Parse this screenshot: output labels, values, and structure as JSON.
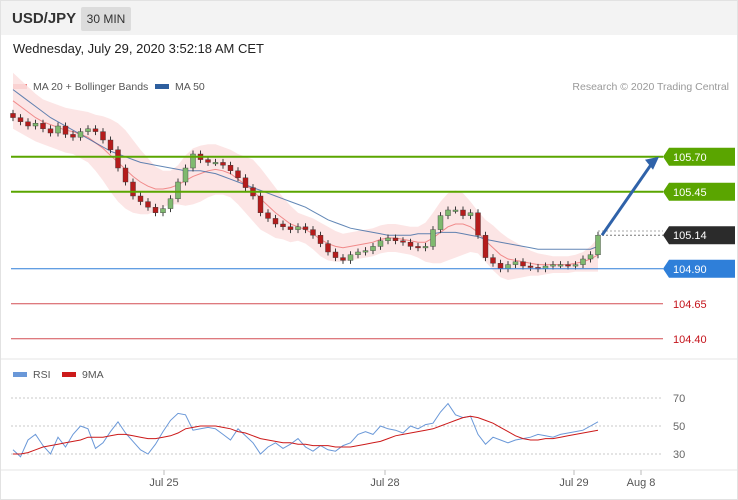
{
  "header": {
    "symbol": "USD/JPY",
    "timeframe": "30 MIN",
    "timestamp": "Wednesday, July 29, 2020 3:52:18 AM CET"
  },
  "credit": "Research © 2020 Trading Central",
  "colors": {
    "ma20_bands": "#f08080",
    "band_fill": "#fbe0e0",
    "ma50": "#2e5f9e",
    "resistance": "#5aa500",
    "support_blue": "#2f7fd9",
    "support_red": "#c4131b",
    "candle_up": "#7fb96f",
    "candle_down": "#b51c1c",
    "rsi": "#6a98d8",
    "rsi_ma": "#cc1a1a"
  },
  "chart_data": [
    {
      "type": "candlestick",
      "name": "price",
      "legend": [
        "MA 20 + Bollinger Bands",
        "MA 50"
      ],
      "x_ticks": [
        "Jul 25",
        "Jul 28",
        "Jul 29",
        "Aug 8"
      ],
      "ylim": [
        104.32,
        106.02
      ],
      "levels": [
        {
          "label": "105.70",
          "value": 105.7,
          "kind": "resistance",
          "color": "#5aa500",
          "text": "#ffffff"
        },
        {
          "label": "105.45",
          "value": 105.45,
          "kind": "resistance",
          "color": "#5aa500",
          "text": "#ffffff"
        },
        {
          "label": "105.14",
          "value": 105.14,
          "kind": "last",
          "color": "#2b2b2b",
          "text": "#ffffff"
        },
        {
          "label": "104.90",
          "value": 104.9,
          "kind": "support",
          "color": "#2f7fd9",
          "text": "#ffffff"
        },
        {
          "label": "104.65",
          "value": 104.65,
          "kind": "support",
          "color": "#c4131b",
          "text": "#c4131b"
        },
        {
          "label": "104.40",
          "value": 104.4,
          "kind": "support",
          "color": "#c4131b",
          "text": "#c4131b"
        }
      ],
      "close": [
        105.98,
        105.95,
        105.92,
        105.94,
        105.9,
        105.87,
        105.92,
        105.86,
        105.84,
        105.88,
        105.9,
        105.88,
        105.82,
        105.75,
        105.62,
        105.52,
        105.42,
        105.38,
        105.34,
        105.3,
        105.33,
        105.4,
        105.52,
        105.62,
        105.72,
        105.68,
        105.66,
        105.66,
        105.64,
        105.6,
        105.55,
        105.48,
        105.42,
        105.3,
        105.26,
        105.22,
        105.2,
        105.18,
        105.2,
        105.18,
        105.14,
        105.08,
        105.02,
        104.98,
        104.96,
        105.0,
        105.02,
        105.03,
        105.06,
        105.1,
        105.12,
        105.1,
        105.09,
        105.06,
        105.05,
        105.06,
        105.18,
        105.28,
        105.32,
        105.32,
        105.28,
        105.3,
        105.14,
        104.98,
        104.94,
        104.9,
        104.93,
        104.95,
        104.92,
        104.91,
        104.9,
        104.92,
        104.93,
        104.93,
        104.92,
        104.93,
        104.97,
        105.0,
        105.14
      ],
      "ma50": [
        106.18,
        106.14,
        106.1,
        106.06,
        106.02,
        105.98,
        105.95,
        105.92,
        105.89,
        105.86,
        105.83,
        105.8,
        105.77,
        105.74,
        105.72,
        105.7,
        105.68,
        105.66,
        105.65,
        105.64,
        105.63,
        105.62,
        105.61,
        105.6,
        105.6,
        105.6,
        105.59,
        105.58,
        105.56,
        105.54,
        105.52,
        105.5,
        105.48,
        105.46,
        105.44,
        105.42,
        105.4,
        105.38,
        105.36,
        105.34,
        105.31,
        105.28,
        105.25,
        105.23,
        105.21,
        105.19,
        105.18,
        105.17,
        105.16,
        105.15,
        105.14,
        105.14,
        105.14,
        105.14,
        105.15,
        105.15,
        105.15,
        105.16,
        105.16,
        105.16,
        105.15,
        105.14,
        105.13,
        105.11,
        105.1,
        105.09,
        105.08,
        105.07,
        105.06,
        105.05,
        105.04,
        105.04,
        105.04,
        105.04,
        105.04,
        105.04,
        105.04,
        105.04,
        105.06
      ],
      "ma20": [
        106.1,
        106.06,
        106.02,
        105.98,
        105.95,
        105.93,
        105.91,
        105.89,
        105.88,
        105.86,
        105.84,
        105.8,
        105.76,
        105.71,
        105.66,
        105.61,
        105.56,
        105.52,
        105.49,
        105.47,
        105.47,
        105.48,
        105.5,
        105.53,
        105.56,
        105.58,
        105.6,
        105.61,
        105.6,
        105.58,
        105.54,
        105.5,
        105.46,
        105.4,
        105.35,
        105.3,
        105.26,
        105.22,
        105.2,
        105.18,
        105.15,
        105.11,
        105.08,
        105.06,
        105.05,
        105.06,
        105.07,
        105.08,
        105.09,
        105.11,
        105.12,
        105.12,
        105.11,
        105.1,
        105.09,
        105.09,
        105.12,
        105.16,
        105.2,
        105.22,
        105.22,
        105.2,
        105.16,
        105.1,
        105.05,
        105.0,
        104.97,
        104.96,
        104.95,
        104.94,
        104.93,
        104.93,
        104.93,
        104.93,
        104.93,
        104.94,
        104.95,
        104.97,
        105.0
      ],
      "bb_width": [
        0.2,
        0.19,
        0.18,
        0.17,
        0.16,
        0.16,
        0.16,
        0.16,
        0.16,
        0.17,
        0.18,
        0.2,
        0.23,
        0.26,
        0.28,
        0.28,
        0.26,
        0.23,
        0.2,
        0.16,
        0.13,
        0.12,
        0.14,
        0.18,
        0.2,
        0.2,
        0.19,
        0.18,
        0.17,
        0.17,
        0.18,
        0.2,
        0.22,
        0.22,
        0.2,
        0.18,
        0.15,
        0.13,
        0.1,
        0.1,
        0.11,
        0.12,
        0.12,
        0.11,
        0.1,
        0.1,
        0.1,
        0.1,
        0.1,
        0.1,
        0.1,
        0.1,
        0.1,
        0.1,
        0.11,
        0.14,
        0.18,
        0.22,
        0.24,
        0.24,
        0.22,
        0.18,
        0.15,
        0.15,
        0.16,
        0.16,
        0.15,
        0.13,
        0.11,
        0.09,
        0.08,
        0.07,
        0.06,
        0.06,
        0.06,
        0.06,
        0.07,
        0.09,
        0.12
      ]
    },
    {
      "type": "line",
      "name": "RSI",
      "legend": [
        "RSI",
        "9MA"
      ],
      "y_ticks": [
        70,
        50,
        30
      ],
      "ylim": [
        20,
        80
      ],
      "rsi": [
        33,
        28,
        40,
        44,
        36,
        30,
        42,
        35,
        44,
        50,
        48,
        34,
        38,
        46,
        53,
        45,
        39,
        33,
        30,
        37,
        46,
        54,
        59,
        58,
        47,
        48,
        49,
        48,
        44,
        40,
        48,
        43,
        38,
        30,
        35,
        38,
        34,
        37,
        41,
        35,
        32,
        36,
        33,
        32,
        36,
        38,
        44,
        46,
        44,
        50,
        48,
        47,
        45,
        50,
        48,
        51,
        52,
        60,
        66,
        58,
        56,
        57,
        44,
        37,
        42,
        40,
        38,
        40,
        41,
        42,
        44,
        43,
        42,
        44,
        45,
        46,
        47,
        50,
        53
      ],
      "rsi_ma": [
        30,
        30,
        31,
        33,
        35,
        36,
        37,
        38,
        39,
        40,
        42,
        42,
        42,
        43,
        44,
        44,
        43,
        42,
        41,
        41,
        42,
        43,
        45,
        48,
        49,
        50,
        50,
        50,
        49,
        48,
        46,
        45,
        43,
        41,
        40,
        39,
        38,
        38,
        37,
        37,
        36,
        36,
        36,
        35,
        35,
        35,
        36,
        37,
        38,
        39,
        41,
        43,
        44,
        45,
        46,
        47,
        48,
        50,
        52,
        54,
        56,
        57,
        56,
        54,
        52,
        49,
        46,
        43,
        41,
        40,
        40,
        41,
        41,
        42,
        43,
        44,
        45,
        46,
        47
      ]
    }
  ]
}
